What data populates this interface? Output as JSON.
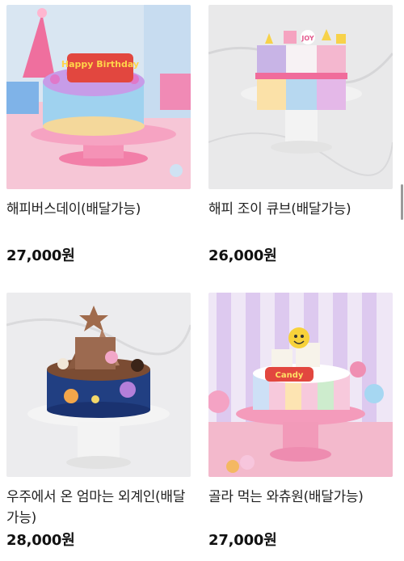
{
  "products": [
    {
      "name": "해피버스데이(배달가능)",
      "price": "27,000원",
      "image": "happy-birthday-cake",
      "topper_text": "Happy Birthday"
    },
    {
      "name": "해피 조이 큐브(배달가능)",
      "price": "26,000원",
      "image": "happy-joy-cube-cake",
      "topper_text": "JOY"
    },
    {
      "name": "우주에서 온 엄마는 외계인(배달가능)",
      "price": "28,000원",
      "image": "space-mom-alien-cake"
    },
    {
      "name": "골라 먹는 와츄원(배달가능)",
      "price": "27,000원",
      "image": "whatchu-one-cake",
      "topper_text": "Candy"
    }
  ],
  "colors": {
    "price": "#111111",
    "name": "#222222",
    "pink": "#f4a7c3",
    "lavender": "#d8c9ee"
  }
}
